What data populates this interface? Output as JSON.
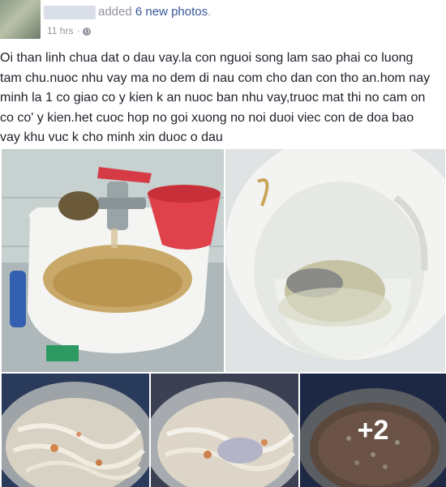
{
  "post": {
    "header": {
      "action_prefix": "added ",
      "action_link": "6 new photos",
      "action_suffix": ".",
      "timestamp": "11 hrs",
      "separator": "·"
    },
    "text_lines": [
      "Oi than linh chua dat o dau vay.la con nguoi song lam sao phai co luong",
      "tam chu.nuoc nhu vay ma no dem di nau com cho dan con tho an.hom nay",
      "minh la 1 co giao co y kien k an nuoc ban nhu vay,truoc mat thi no cam on",
      "co co' y kien.het cuoc hop no goi xuong no noi duoi viec con de doa bao",
      "vay khu vuc k cho minh xin duoc o dau"
    ],
    "photos": {
      "more_count": "+2"
    },
    "colors": {
      "link": "#365899",
      "meta": "#90949c",
      "text": "#1d2129"
    },
    "icons": [
      "globe-icon"
    ]
  }
}
